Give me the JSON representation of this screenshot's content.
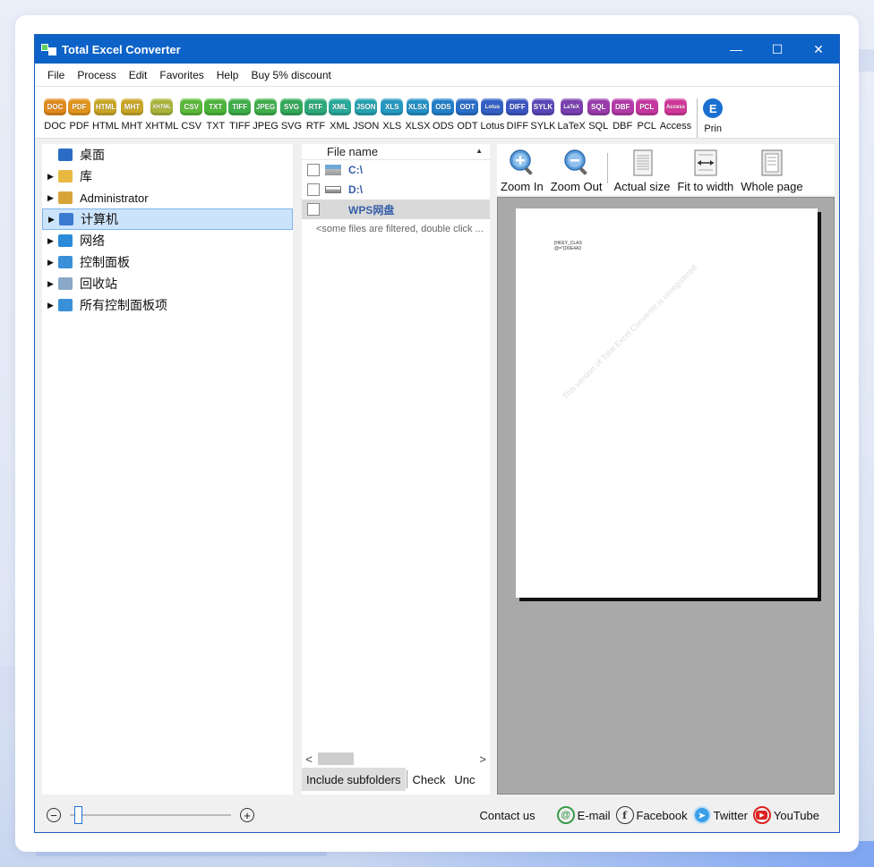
{
  "window": {
    "title": "Total Excel Converter",
    "controls": {
      "minimize": "—",
      "maximize": "☐",
      "close": "✕"
    }
  },
  "menu": [
    "File",
    "Process",
    "Edit",
    "Favorites",
    "Help",
    "Buy 5% discount"
  ],
  "formats": [
    {
      "icon": "DOC",
      "label": "DOC",
      "color": "#e08a1e"
    },
    {
      "icon": "PDF",
      "label": "PDF",
      "color": "#e0941e"
    },
    {
      "icon": "HTML",
      "label": "HTML",
      "color": "#c9a628"
    },
    {
      "icon": "MHT",
      "label": "MHT",
      "color": "#c9a628"
    },
    {
      "icon": "XHTML",
      "label": "XHTML",
      "color": "#a9b43c"
    },
    {
      "icon": "CSV",
      "label": "CSV",
      "color": "#5bb83a"
    },
    {
      "icon": "TXT",
      "label": "TXT",
      "color": "#4cb43a"
    },
    {
      "icon": "TIFF",
      "label": "TIFF",
      "color": "#3fae4a"
    },
    {
      "icon": "JPEG",
      "label": "JPEG",
      "color": "#3fae4a"
    },
    {
      "icon": "SVG",
      "label": "SVG",
      "color": "#33a85a"
    },
    {
      "icon": "RTF",
      "label": "RTF",
      "color": "#2ea87a"
    },
    {
      "icon": "XML",
      "label": "XML",
      "color": "#2aa89a"
    },
    {
      "icon": "JSON",
      "label": "JSON",
      "color": "#26a2b0"
    },
    {
      "icon": "XLS",
      "label": "XLS",
      "color": "#2498c0"
    },
    {
      "icon": "XLSX",
      "label": "XLSX",
      "color": "#2290c4"
    },
    {
      "icon": "ODS",
      "label": "ODS",
      "color": "#2380c8"
    },
    {
      "icon": "ODT",
      "label": "ODT",
      "color": "#2a6ec8"
    },
    {
      "icon": "Lotus",
      "label": "Lotus",
      "color": "#3460c4"
    },
    {
      "icon": "DIFF",
      "label": "DIFF",
      "color": "#3c56c0"
    },
    {
      "icon": "SYLK",
      "label": "SYLK",
      "color": "#5a48b8"
    },
    {
      "icon": "LaTeX",
      "label": "LaTeX",
      "color": "#7a40b0"
    },
    {
      "icon": "SQL",
      "label": "SQL",
      "color": "#9a3cac"
    },
    {
      "icon": "DBF",
      "label": "DBF",
      "color": "#b23aa8"
    },
    {
      "icon": "PCL",
      "label": "PCL",
      "color": "#c438a0"
    },
    {
      "icon": "Access",
      "label": "Access",
      "color": "#d03898"
    }
  ],
  "print_label": "Prin",
  "tree": [
    {
      "label": "桌面",
      "has_arrow": false,
      "icon_color": "#2b6cc4"
    },
    {
      "label": "库",
      "has_arrow": true,
      "icon_color": "#e8b842"
    },
    {
      "label": "Administrator",
      "has_arrow": true,
      "icon_color": "#d8a43a"
    },
    {
      "label": "计算机",
      "has_arrow": true,
      "icon_color": "#3a7ad0",
      "selected": true
    },
    {
      "label": "网络",
      "has_arrow": true,
      "icon_color": "#2a8ad8"
    },
    {
      "label": "控制面板",
      "has_arrow": true,
      "icon_color": "#3a90d8"
    },
    {
      "label": "回收站",
      "has_arrow": true,
      "icon_color": "#8aa8c8"
    },
    {
      "label": "所有控制面板项",
      "has_arrow": true,
      "icon_color": "#3a90d8"
    }
  ],
  "files": {
    "header": "File name",
    "rows": [
      {
        "name": "C:\\",
        "selected": false
      },
      {
        "name": "D:\\",
        "selected": false
      },
      {
        "name": "WPS网盘",
        "selected": true
      }
    ],
    "filtered_note": "<some files are filtered, double click ...",
    "scroll_left": "<",
    "scroll_right": ">",
    "bottom": {
      "include_subfolders": "Include subfolders",
      "check": "Check",
      "uncheck": "Unc"
    }
  },
  "preview": {
    "buttons": {
      "zoom_in": "Zoom In",
      "zoom_out": "Zoom Out",
      "actual_size": "Actual size",
      "fit_to_width": "Fit to width",
      "whole_page": "Whole page"
    },
    "page_text_line1": "[HKEY_CLAS",
    "page_text_line2": "@=\"{D0E4A3",
    "watermark": "This version of Total Excel Converter is unregistered"
  },
  "status": {
    "zoom_minus": "−",
    "zoom_plus": "+",
    "zoom_level": 0.03,
    "contact": "Contact us",
    "email": "E-mail",
    "facebook": "Facebook",
    "twitter": "Twitter",
    "youtube": "YouTube"
  }
}
